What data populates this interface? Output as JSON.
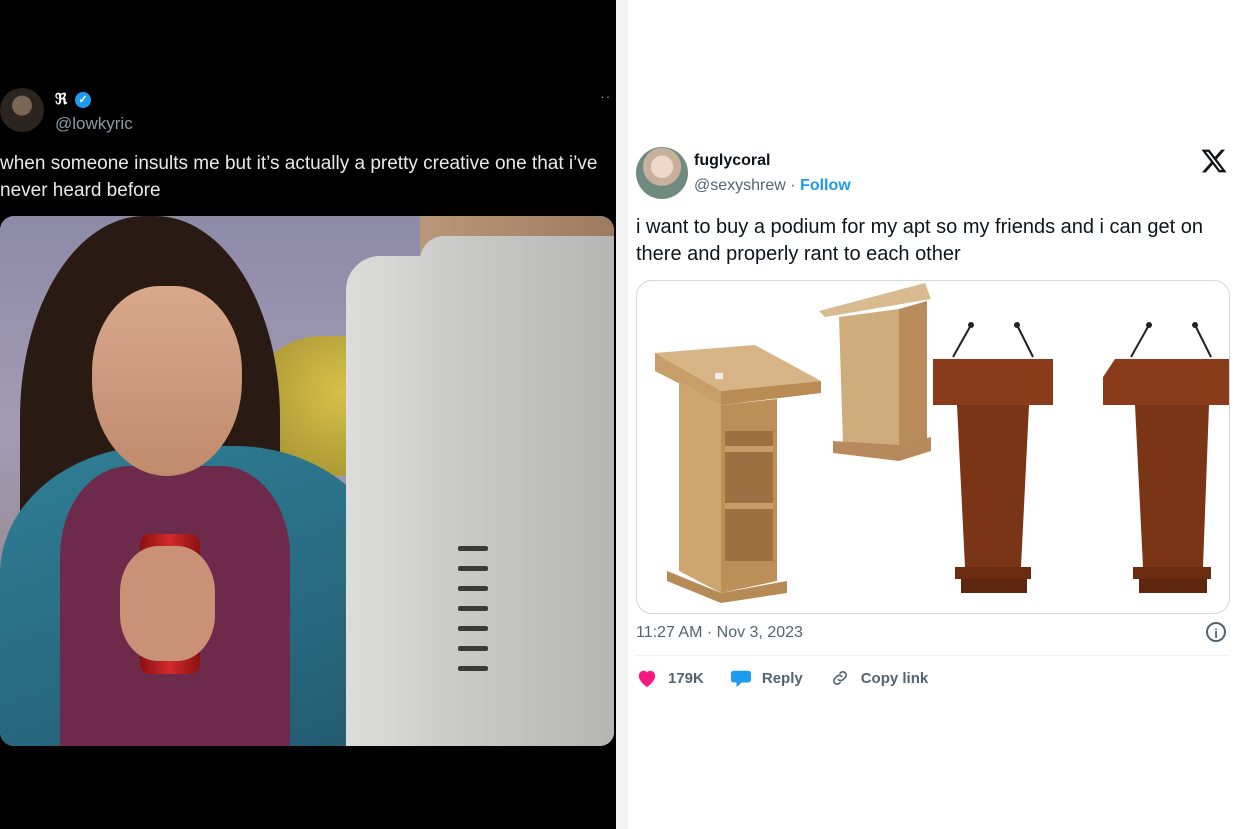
{
  "left_tweet": {
    "display_name": "ℜ",
    "verified_mark": "✓",
    "handle": "@lowkyric",
    "more": "··",
    "text": "when someone insults me but it’s actually a pretty creative one that i’ve never heard before",
    "image_icon": "photo-of-girl-at-computer"
  },
  "right_tweet": {
    "display_name": "fuglycoral",
    "handle": "@sexyshrew",
    "separator": " · ",
    "follow_label": "Follow",
    "text": "i want to buy a podium for my apt so my friends and i can get on there and properly rant to each other",
    "timestamp": "11:27 AM · Nov 3, 2023",
    "info_icon": "i",
    "actions": {
      "like_count": "179K",
      "reply_label": "Reply",
      "copy_link_label": "Copy link"
    },
    "colors": {
      "like": "#f91880",
      "reply": "#1d9bf0",
      "follow": "#1d9bf0"
    }
  }
}
